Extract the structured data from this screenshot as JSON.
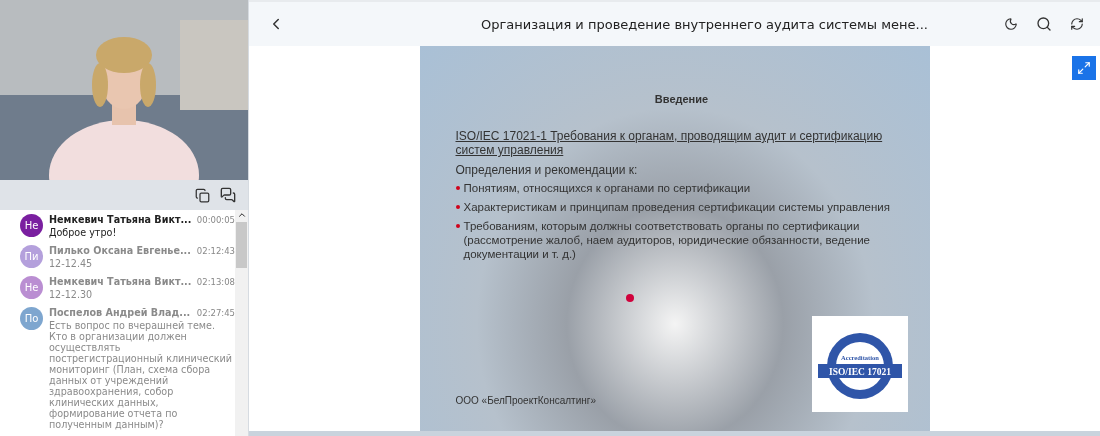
{
  "header": {
    "title": "Организация и проведение внутреннего аудита системы мене..."
  },
  "chat": {
    "messages": [
      {
        "initials": "Не",
        "color": "#7a1fa0",
        "author": "Немкевич Татьяна Викт...",
        "time": "00:00:05",
        "text": "Доброе утро!",
        "unread": true
      },
      {
        "initials": "Пи",
        "color": "#b4a0dc",
        "author": "Пилько Оксана Евгенье...",
        "time": "02:12:43",
        "text": "12-12.45",
        "unread": false
      },
      {
        "initials": "Не",
        "color": "#ba8ed2",
        "author": "Немкевич Татьяна Викт...",
        "time": "02:13:08",
        "text": "12-12.30",
        "unread": false
      },
      {
        "initials": "По",
        "color": "#7ea6cf",
        "author": "Поспелов Андрей Влад...",
        "time": "02:27:45",
        "text": "Есть вопрос по вчерашней теме. Кто в организации должен осуществлять пострегистрационный клинический мониторинг (План, схема сбора данных от учреждений здравоохранения, собор клинических данных, формирование отчета по полученным данным)?",
        "unread": false
      }
    ]
  },
  "slide": {
    "heading": "Введение",
    "standard": "ISO/IEC 17021-1  Требования к органам, проводящим аудит и сертификацию систем управления",
    "intro": "Определения и рекомендации к:",
    "bullets": [
      "Понятиям, относящихся к органами по сертификации",
      "Характеристикам и принципам проведения сертификации системы управления",
      "Требованиям, которым должны соответствовать органы по сертификации (рассмотрение жалоб, наем аудиторов, юридические обязанности, ведение документации и т. д.)"
    ],
    "company": "ООО «БелПроектКонсалтинг»",
    "logo": {
      "label": "Accreditation",
      "standard": "ISO/IEC 17021"
    }
  }
}
